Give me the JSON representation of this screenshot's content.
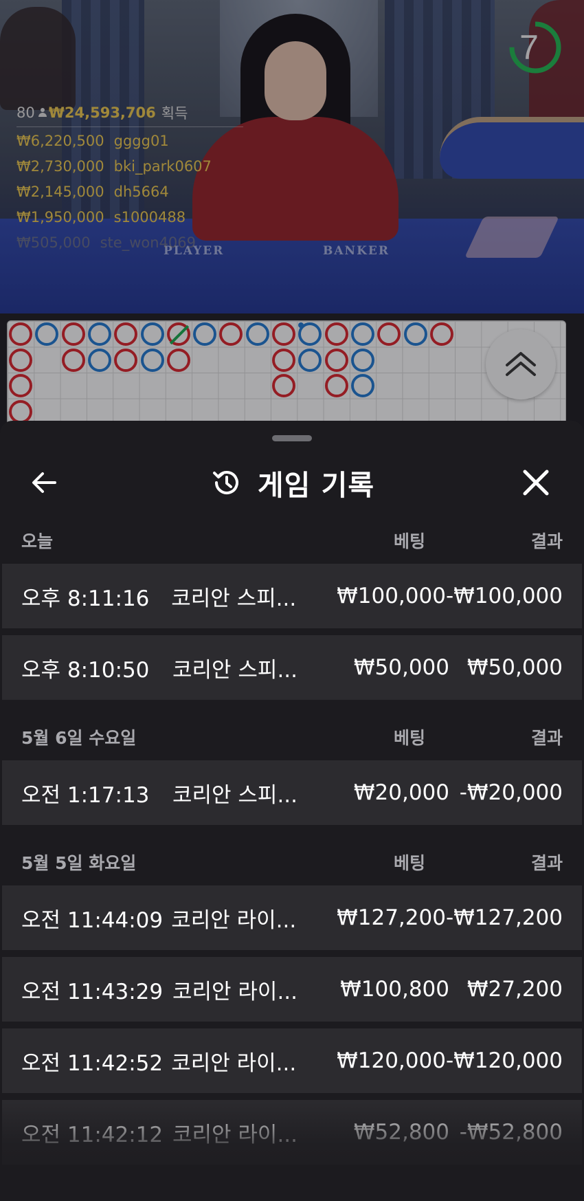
{
  "live": {
    "table_labels": {
      "player": "PLAYER",
      "banker": "BANKER"
    },
    "stats": {
      "count": "80",
      "total": "₩24,593,706",
      "won_label": "획득"
    },
    "winners": [
      {
        "amount": "₩6,220,500",
        "user": "gggg01"
      },
      {
        "amount": "₩2,730,000",
        "user": "bki_park0607"
      },
      {
        "amount": "₩2,145,000",
        "user": "dh5664"
      },
      {
        "amount": "₩1,950,000",
        "user": "s1000488"
      },
      {
        "amount": "₩505,000",
        "user": "ste_won4069"
      }
    ],
    "countdown": {
      "value": "7",
      "progress": 0.75,
      "color": "#1fb04d"
    }
  },
  "bead_road": {
    "colors": {
      "banker": "#d2232a",
      "player": "#1f73c8",
      "tie": "#17a24a"
    },
    "columns": [
      [
        "B",
        "B",
        "B",
        "B"
      ],
      [
        "P"
      ],
      [
        "B",
        "B"
      ],
      [
        "P",
        "P"
      ],
      [
        "B",
        "B"
      ],
      [
        "P",
        "P"
      ],
      [
        "T",
        "B"
      ],
      [
        "P"
      ],
      [
        "B"
      ],
      [
        "P"
      ],
      [
        "B",
        "B",
        "B"
      ],
      [
        "P*",
        "P"
      ],
      [
        "B",
        "B",
        "B"
      ],
      [
        "P",
        "P",
        "P"
      ],
      [
        "B"
      ],
      [
        "P"
      ],
      [
        "B"
      ]
    ]
  },
  "sheet": {
    "title": "게임 기록",
    "sections": [
      {
        "date": "오늘",
        "bet_header": "베팅",
        "result_header": "결과",
        "rows": [
          {
            "time": "오후 8:11:16",
            "game": "코리안 스피...",
            "bet": "₩100,000",
            "result": "-₩100,000"
          },
          {
            "time": "오후 8:10:50",
            "game": "코리안 스피...",
            "bet": "₩50,000",
            "result": "₩50,000"
          }
        ]
      },
      {
        "date": "5월 6일 수요일",
        "bet_header": "베팅",
        "result_header": "결과",
        "rows": [
          {
            "time": "오전 1:17:13",
            "game": "코리안 스피...",
            "bet": "₩20,000",
            "result": "-₩20,000"
          }
        ]
      },
      {
        "date": "5월 5일 화요일",
        "bet_header": "베팅",
        "result_header": "결과",
        "rows": [
          {
            "time": "오전 11:44:09",
            "game": "코리안 라이...",
            "bet": "₩127,200",
            "result": "-₩127,200"
          },
          {
            "time": "오전 11:43:29",
            "game": "코리안 라이...",
            "bet": "₩100,800",
            "result": "₩27,200"
          },
          {
            "time": "오전 11:42:52",
            "game": "코리안 라이...",
            "bet": "₩120,000",
            "result": "-₩120,000"
          },
          {
            "time": "오전 11:42:12",
            "game": "코리안 라이...",
            "bet": "₩52,800",
            "result": "-₩52,800"
          }
        ]
      }
    ]
  }
}
